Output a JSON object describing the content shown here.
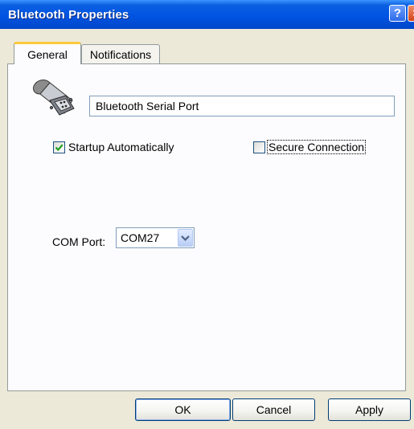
{
  "window": {
    "title": "Bluetooth Properties",
    "help_glyph": "?",
    "close_glyph": "×"
  },
  "tabs": [
    {
      "label": "General",
      "active": true
    },
    {
      "label": "Notifications",
      "active": false
    }
  ],
  "general": {
    "device_name": "Bluetooth Serial Port",
    "startup": {
      "label": "Startup Automatically",
      "checked": true
    },
    "secure": {
      "label": "Secure Connection",
      "checked": false
    },
    "com_port": {
      "label": "COM Port:",
      "value": "COM27"
    }
  },
  "buttons": {
    "ok": "OK",
    "cancel": "Cancel",
    "apply": "Apply"
  },
  "colors": {
    "title_bar": "#0054e3",
    "face": "#ece9d8",
    "active_tab_accent": "#ffc83c",
    "check": "#21a121"
  },
  "icons": {
    "device": "serial-port-connector-icon",
    "checkmark": "checkmark-icon",
    "dropdown": "chevron-down-icon"
  }
}
